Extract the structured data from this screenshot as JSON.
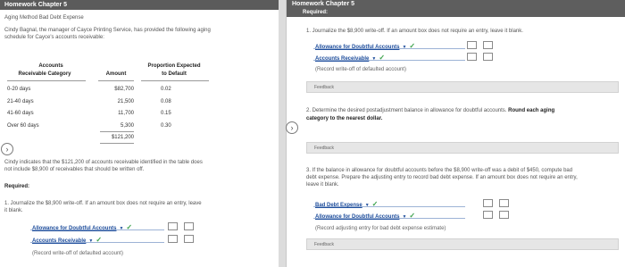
{
  "left": {
    "header": "Homework Chapter 5",
    "subtitle": "Aging Method Bad Debt Expense",
    "intro_line1": "Cindy Bagnal, the manager of Cayce Printing Service, has provided the following aging",
    "intro_line2": "schedule for Cayce's accounts receivable:",
    "table": {
      "col1_line1": "Accounts",
      "col1_line2": "Receivable Category",
      "col2": "Amount",
      "col3_line1": "Proportion Expected",
      "col3_line2": "to Default",
      "rows": [
        {
          "category": "0-20 days",
          "amount": "$82,700",
          "proportion": "0.02"
        },
        {
          "category": "21-40 days",
          "amount": "21,500",
          "proportion": "0.08"
        },
        {
          "category": "41-60 days",
          "amount": "11,700",
          "proportion": "0.15"
        },
        {
          "category": "Over 60 days",
          "amount": "5,300",
          "proportion": "0.30"
        }
      ],
      "total": "$121,200"
    },
    "para_line1": "Cindy indicates that the $121,200 of accounts receivable identified in the table does",
    "para_line2": "not include $8,900 of receivables that should be written off.",
    "required": "Required:",
    "q1_line1": "1.  Journalize the $8,900 write-off. If an amount box does not require an entry, leave",
    "q1_line2": "it blank.",
    "entry1": "Allowance for Doubtful Accounts",
    "entry2": "Accounts Receivable",
    "entry_note": "(Record write-off of defaulted account)"
  },
  "right": {
    "header": "Homework Chapter 5",
    "required": "Required:",
    "q1": "1.  Journalize the $8,900 write-off. If an amount box does not require an entry, leave it blank.",
    "q1_entry1": "Allowance for Doubtful Accounts",
    "q1_entry2": "Accounts Receivable",
    "q1_note": "(Record write-off of defaulted account)",
    "feedback": "Feedback",
    "q2_line1_a": "2.  Determine the desired postadjustment balance in allowance for doubtful accounts. ",
    "q2_line1_b": "Round each aging",
    "q2_line2": "category to the nearest dollar.",
    "q3_line1": "3.  If the balance in allowance for doubtful accounts before the $8,900 write-off was a debit of $450, compute bad",
    "q3_line2": "debt expense. Prepare the adjusting entry to record bad debt expense. If an amount box does not require an entry,",
    "q3_line3": "leave it blank.",
    "q3_entry1": "Bad Debt Expense",
    "q3_entry2": "Allowance for Doubtful Accounts",
    "q3_note": "(Record adjusting entry for bad debt expense estimate)"
  },
  "icons": {
    "nav_left": "chevron-right-icon",
    "nav_right": "chevron-right-icon",
    "check": "checkmark-icon",
    "dropdown": "chevron-down-icon"
  },
  "colors": {
    "header": "#5b5b5b",
    "link": "#1f4e9c",
    "check": "#3aa14a"
  }
}
